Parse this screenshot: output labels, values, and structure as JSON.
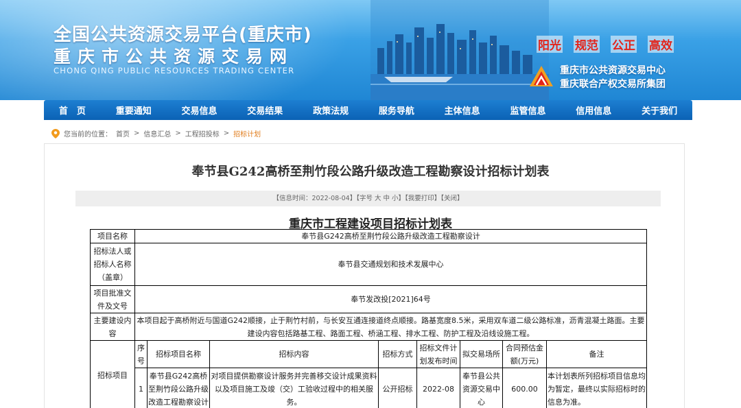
{
  "header": {
    "title_line1": "全国公共资源交易平台(重庆市)",
    "title_line2": "重庆市公共资源交易网",
    "title_en": "CHONG QING PUBLIC RESOURCES TRADING CENTER",
    "slogans": [
      "阳光",
      "规范",
      "公正",
      "高效"
    ],
    "org_lines": [
      "重庆市公共资源交易中心",
      "重庆联合产权交易所集团"
    ]
  },
  "nav": {
    "items": [
      "首　页",
      "重要通知",
      "交易信息",
      "交易结果",
      "政策法规",
      "服务导航",
      "主体信息",
      "监管信息",
      "信用信息",
      "关于我们"
    ]
  },
  "breadcrumb": {
    "prefix": "您当前的位置：",
    "items": [
      "首页",
      "信息汇总",
      "工程招投标",
      "招标计划"
    ],
    "sep": ">"
  },
  "article": {
    "title": "奉节县G242高桥至荆竹段公路升级改造工程勘察设计招标计划表",
    "meta": "【信息时间：2022-08-04】【字号 大 中 小】【我要打印】【关闭】"
  },
  "table": {
    "title": "重庆市工程建设项目招标计划表",
    "rows": {
      "project_name": {
        "label": "项目名称",
        "value": "奉节县G242高桥至荆竹段公路升级改造工程勘察设计"
      },
      "tenderer": {
        "label": "招标法人或招标人名称（盖章）",
        "value": "奉节县交通规划和技术发展中心"
      },
      "approval": {
        "label": "项目批准文件及文号",
        "value": "奉节发改投[2021]64号"
      },
      "content": {
        "label": "主要建设内容",
        "value": "本项目起于高桥附近与国道G242顺接，止于荆竹村前，与长安互通连接道终点顺接。路基宽度8.5米，采用双车道二级公路标准，沥青混凝土路面。主要建设内容包括路基工程、路面工程、桥涵工程、排水工程、防护工程及沿线设施工程。"
      }
    },
    "items_label": "招标项目",
    "columns": [
      "序号",
      "招标项目名称",
      "招标内容",
      "招标方式",
      "招标文件计划发布时间",
      "拟交易场所",
      "合同预估金额(万元)",
      "备注"
    ],
    "items": [
      {
        "no": "1",
        "name": "奉节县G242高桥至荆竹段公路升级改造工程勘察设计",
        "content": "对项目提供勘察设计服务并完善移交设计成果资料以及项目施工及竣（交）工验收过程中的相关服务。",
        "method": "公开招标",
        "publish": "2022-08",
        "venue": "奉节县公共资源交易中心",
        "amount": "600.00",
        "remark": "本计划表所列招标项目信息均为暂定，最终以实际招标时的信息为准。"
      }
    ]
  },
  "colors": {
    "nav_bg": "#0b62b5",
    "slogan": "#e3241b",
    "crumb_current": "#e07b1a"
  },
  "icons": [
    "location-pin-icon",
    "org-logo-icon"
  ]
}
